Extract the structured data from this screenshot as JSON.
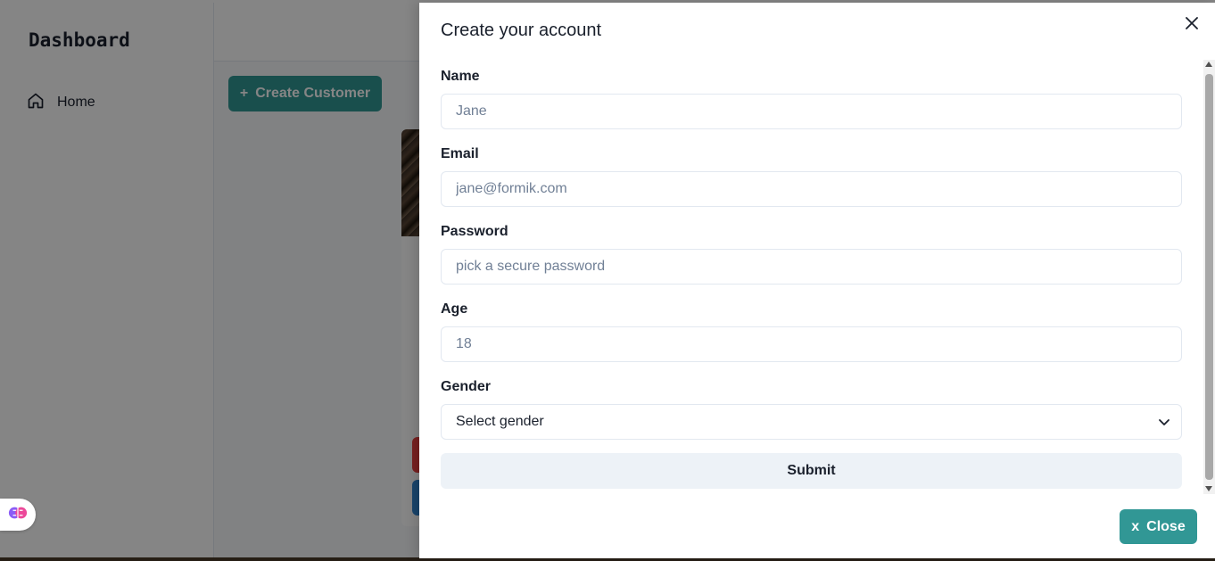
{
  "app": {
    "brand": "Dashboard",
    "nav": {
      "home_label": "Home"
    },
    "create_button_label": "Create Customer",
    "create_button_icon": "+"
  },
  "drawer": {
    "title": "Create your account",
    "fields": {
      "name": {
        "label": "Name",
        "placeholder": "Jane",
        "value": ""
      },
      "email": {
        "label": "Email",
        "placeholder": "jane@formik.com",
        "value": ""
      },
      "password": {
        "label": "Password",
        "placeholder": "pick a secure password",
        "value": ""
      },
      "age": {
        "label": "Age",
        "placeholder": "18",
        "value": ""
      },
      "gender": {
        "label": "Gender",
        "selected": "Select gender"
      }
    },
    "submit_label": "Submit",
    "footer_close_label": "Close",
    "footer_close_prefix": "x"
  },
  "colors": {
    "accent": "#319795",
    "danger": "#e53e3e",
    "primary": "#3182ce",
    "submit_bg": "#edf2f7"
  }
}
